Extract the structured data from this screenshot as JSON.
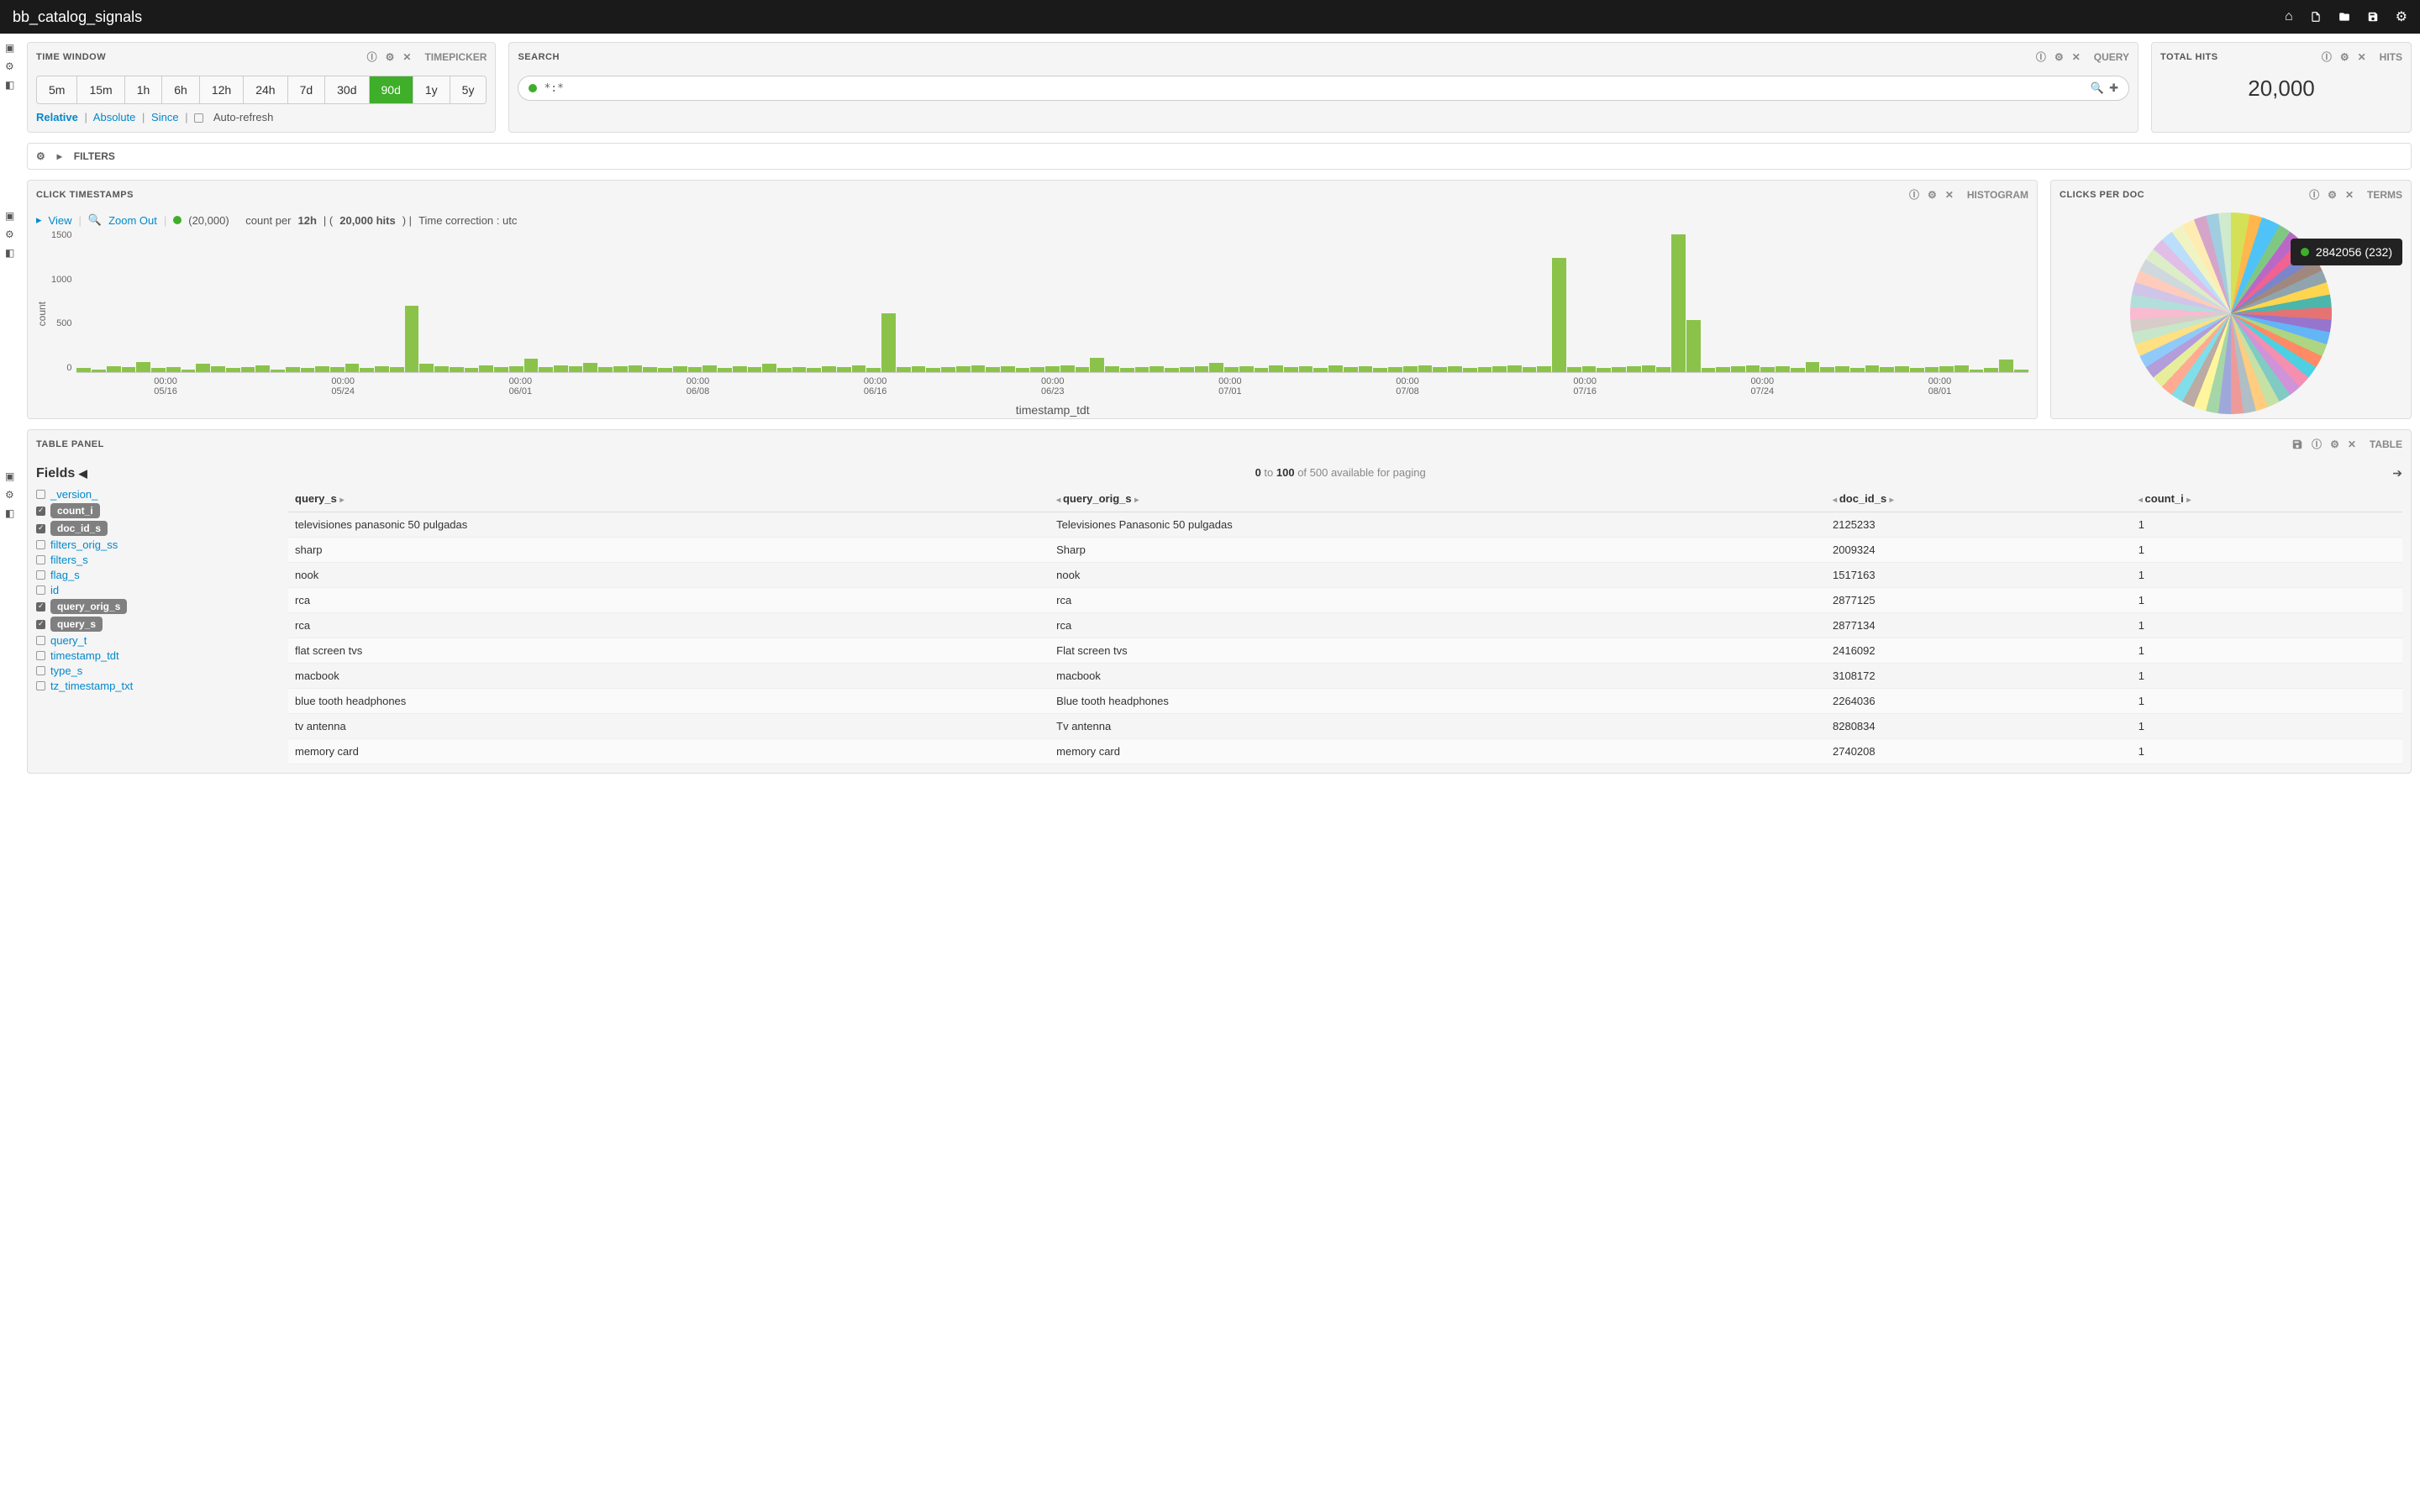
{
  "topbar": {
    "title": "bb_catalog_signals"
  },
  "timewindow": {
    "title": "TIME WINDOW",
    "type": "TIMEPICKER",
    "buttons": [
      "5m",
      "15m",
      "1h",
      "6h",
      "12h",
      "24h",
      "7d",
      "30d",
      "90d",
      "1y",
      "5y"
    ],
    "active": "90d",
    "links": {
      "relative": "Relative",
      "absolute": "Absolute",
      "since": "Since"
    },
    "autorefresh": "Auto-refresh"
  },
  "search": {
    "title": "SEARCH",
    "type": "QUERY",
    "query": "*:*"
  },
  "totalhits": {
    "title": "TOTAL HITS",
    "type": "HITS",
    "value": "20,000"
  },
  "filters": {
    "label": "FILTERS"
  },
  "histogram": {
    "title": "CLICK TIMESTAMPS",
    "type": "HISTOGRAM",
    "view": "View",
    "zoom": "Zoom Out",
    "count_text": "(20,000)",
    "per_label": "count per",
    "interval": "12h",
    "hits_sep": "| (",
    "hits": "20,000 hits",
    "hits_close": ") |",
    "correction": "Time correction : utc",
    "ylabel": "count",
    "xlabel": "timestamp_tdt",
    "yticks": [
      "1500",
      "1000",
      "500",
      "0"
    ],
    "xticks": [
      {
        "t": "00:00",
        "d": "05/16"
      },
      {
        "t": "00:00",
        "d": "05/24"
      },
      {
        "t": "00:00",
        "d": "06/01"
      },
      {
        "t": "00:00",
        "d": "06/08"
      },
      {
        "t": "00:00",
        "d": "06/16"
      },
      {
        "t": "00:00",
        "d": "06/23"
      },
      {
        "t": "00:00",
        "d": "07/01"
      },
      {
        "t": "00:00",
        "d": "07/08"
      },
      {
        "t": "00:00",
        "d": "07/16"
      },
      {
        "t": "00:00",
        "d": "07/24"
      },
      {
        "t": "00:00",
        "d": "08/01"
      }
    ]
  },
  "chart_data": {
    "type": "bar",
    "title": "CLICK TIMESTAMPS",
    "xlabel": "timestamp_tdt",
    "ylabel": "count",
    "ylim": [
      0,
      1500
    ],
    "interval": "12h",
    "total_hits": 20000,
    "values": [
      40,
      30,
      60,
      50,
      110,
      40,
      50,
      30,
      90,
      60,
      40,
      50,
      70,
      30,
      50,
      40,
      60,
      50,
      90,
      40,
      60,
      50,
      700,
      90,
      60,
      50,
      40,
      70,
      50,
      60,
      140,
      50,
      70,
      60,
      100,
      50,
      60,
      70,
      50,
      40,
      60,
      50,
      70,
      40,
      60,
      50,
      90,
      40,
      50,
      40,
      60,
      50,
      70,
      40,
      620,
      50,
      60,
      40,
      50,
      60,
      70,
      50,
      60,
      40,
      50,
      60,
      70,
      50,
      150,
      60,
      40,
      50,
      60,
      40,
      50,
      60,
      100,
      50,
      60,
      40,
      70,
      50,
      60,
      40,
      70,
      50,
      60,
      40,
      50,
      60,
      70,
      50,
      60,
      40,
      50,
      60,
      70,
      50,
      60,
      1200,
      50,
      60,
      40,
      50,
      60,
      70,
      50,
      1450,
      550,
      40,
      50,
      60,
      70,
      50,
      60,
      40,
      110,
      50,
      60,
      40,
      70,
      50,
      60,
      40,
      50,
      60,
      70,
      30,
      40,
      130,
      30
    ]
  },
  "pie": {
    "title": "CLICKS PER DOC",
    "type": "TERMS",
    "tooltip": "2842056 (232)"
  },
  "tablepanel": {
    "title": "TABLE PANEL",
    "type": "TABLE",
    "fields_label": "Fields",
    "paging_prefix": "0",
    "paging_to": " to ",
    "paging_end": "100",
    "paging_suffix": " of 500 available for paging",
    "fields": [
      {
        "name": "_version_",
        "checked": false
      },
      {
        "name": "count_i",
        "checked": true
      },
      {
        "name": "doc_id_s",
        "checked": true
      },
      {
        "name": "filters_orig_ss",
        "checked": false
      },
      {
        "name": "filters_s",
        "checked": false
      },
      {
        "name": "flag_s",
        "checked": false
      },
      {
        "name": "id",
        "checked": false
      },
      {
        "name": "query_orig_s",
        "checked": true
      },
      {
        "name": "query_s",
        "checked": true
      },
      {
        "name": "query_t",
        "checked": false
      },
      {
        "name": "timestamp_tdt",
        "checked": false
      },
      {
        "name": "type_s",
        "checked": false
      },
      {
        "name": "tz_timestamp_txt",
        "checked": false
      }
    ],
    "columns": [
      "query_s",
      "query_orig_s",
      "doc_id_s",
      "count_i"
    ],
    "rows": [
      [
        "televisiones panasonic 50 pulgadas",
        "Televisiones Panasonic 50 pulgadas",
        "2125233",
        "1"
      ],
      [
        "sharp",
        "Sharp",
        "2009324",
        "1"
      ],
      [
        "nook",
        "nook",
        "1517163",
        "1"
      ],
      [
        "rca",
        "rca",
        "2877125",
        "1"
      ],
      [
        "rca",
        "rca",
        "2877134",
        "1"
      ],
      [
        "flat screen tvs",
        "Flat screen tvs",
        "2416092",
        "1"
      ],
      [
        "macbook",
        "macbook",
        "3108172",
        "1"
      ],
      [
        "blue tooth headphones",
        "Blue tooth headphones",
        "2264036",
        "1"
      ],
      [
        "tv antenna",
        "Tv antenna",
        "8280834",
        "1"
      ],
      [
        "memory card",
        "memory card",
        "2740208",
        "1"
      ]
    ]
  }
}
